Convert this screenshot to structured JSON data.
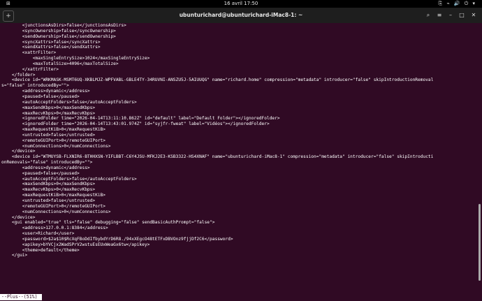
{
  "topbar": {
    "activities": "⊞",
    "datetime": "16 avril  17:50",
    "status_icons": "⎘ ⌁ 🔊 ⏻ ▾"
  },
  "titlebar": {
    "title": "ubunturichard@ubunturichard-iMac8-1: ~",
    "new_tab_icon": "+",
    "search_icon": "⌕",
    "menu_icon": "≡",
    "minimize_icon": "–",
    "maximize_icon": "□",
    "close_icon": "✕"
  },
  "terminal_lines": [
    "        <junctionsAsDirs>false</junctionsAsDirs>",
    "        <syncOwnership>false</syncOwnership>",
    "        <sendOwnership>false</sendOwnership>",
    "        <syncXattrs>false</syncXattrs>",
    "        <sendXattrs>false</sendXattrs>",
    "        <xattrFilter>",
    "            <maxSingleEntrySize>1024</maxSingleEntrySize>",
    "            <maxTotalSize>4096</maxTotalSize>",
    "        </xattrFilter>",
    "    </folder>",
    "    <device id=\"WRKMASK-MSMT6UQ-XKBLMJZ-WPFVABL-GBLE4TY-34RUVNI-ANSZU5J-5AIUUQG\" name=\"richard.home\" compression=\"metadata\" introducer=\"false\" skipIntroductionRemoval",
    "s=\"false\" introducedBy=\"\">",
    "        <address>dynamic</address>",
    "        <paused>false</paused>",
    "        <autoAcceptFolders>false</autoAcceptFolders>",
    "        <maxSendKbps>0</maxSendKbps>",
    "        <maxRecvKbps>0</maxRecvKbps>",
    "        <ignoredFolder time=\"2026-04-14T13:11:10.862Z\" id=\"default\" label=\"Default Folder\"></ignoredFolder>",
    "        <ignoredFolder time=\"2026-04-14T13:43:01.974Z\" id=\"syjfr-fweat\" label=\"Vidéos\"></ignoredFolder>",
    "        <maxRequestKiB>0</maxRequestKiB>",
    "        <untrusted>false</untrusted>",
    "        <remoteGUIPort>0</remoteGUIPort>",
    "        <numConnections>0</numConnections>",
    "    </device>",
    "    <device id=\"WTMUYSB-FLXNIR6-BTHHXSN-YIFLBBT-C6Y4JSU-MFKJ2E3-KSB3322-HS4XNAF\" name=\"ubunturichard-iMac8-1\" compression=\"metadata\" introducer=\"false\" skipIntroducti",
    "onRemovals=\"false\" introducedBy=\"\">",
    "        <address>dynamic</address>",
    "        <paused>false</paused>",
    "        <autoAcceptFolders>false</autoAcceptFolders>",
    "        <maxSendKbps>0</maxSendKbps>",
    "        <maxRecvKbps>0</maxRecvKbps>",
    "        <maxRequestKiB>0</maxRequestKiB>",
    "        <untrusted>false</untrusted>",
    "        <remoteGUIPort>0</remoteGUIPort>",
    "        <numConnections>0</numConnections>",
    "    </device>",
    "    <gui enabled=\"true\" tls=\"false\" debugging=\"false\" sendBasicAuthPrompt=\"false\">",
    "        <address>127.0.0.1:8384</address>",
    "        <user>Richard</user>",
    "        <password>$2a$10$RcXqFBoDdIfbybdYrD6R8./94xXEgcO48tETFxDBVOnz9fjjDf2C6</password>",
    "        <apikey>bYVCjx2WadSPrV2wstuEsEUxWeaGx6tw</apikey>",
    "        <theme>default</theme>",
    "    </gui>"
  ],
  "status_line": "--Plus--(51%)"
}
